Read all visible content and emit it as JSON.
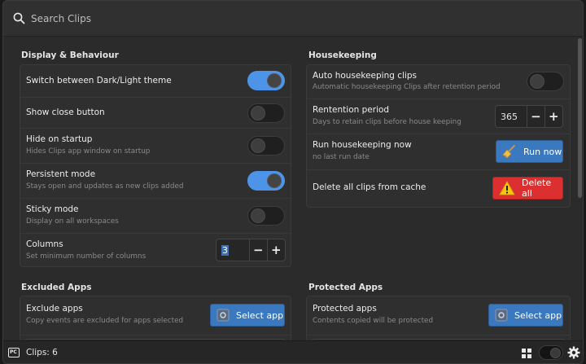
{
  "search": {
    "placeholder": "Search Clips"
  },
  "display": {
    "title": "Display & Behaviour",
    "rows": [
      {
        "title": "Switch between Dark/Light theme",
        "sub": "",
        "toggle": true
      },
      {
        "title": "Show close button",
        "sub": "",
        "toggle": false
      },
      {
        "title": "Hide on startup",
        "sub": "Hides Clips app window on startup",
        "toggle": false
      },
      {
        "title": "Persistent mode",
        "sub": "Stays open and updates as new clips added",
        "toggle": true
      },
      {
        "title": "Sticky mode",
        "sub": "Display on all workspaces",
        "toggle": false
      },
      {
        "title": "Columns",
        "sub": "Set minimum number of columns",
        "value": "3"
      }
    ]
  },
  "housekeeping": {
    "title": "Housekeeping",
    "auto": {
      "title": "Auto housekeeping clips",
      "sub": "Automatic housekeeping Clips after retention period",
      "toggle": false
    },
    "retention": {
      "title": "Rentention period",
      "sub": "Days to retain clips before house keeping",
      "value": "365"
    },
    "run": {
      "title": "Run housekeeping now",
      "sub": "no last run date",
      "button": "Run now"
    },
    "delete": {
      "title": "Delete all clips from cache",
      "button": "Delete all"
    }
  },
  "excluded": {
    "title": "Excluded Apps",
    "row": {
      "title": "Exclude apps",
      "sub": "Copy events are excluded for apps selected",
      "button": "Select app"
    }
  },
  "protected": {
    "title": "Protected Apps",
    "row": {
      "title": "Protected apps",
      "sub": "Contents copied will be protected",
      "button": "Select app"
    }
  },
  "status": {
    "count": "Clips: 6",
    "logo": "PC"
  },
  "colors": {
    "accent": "#4d94e8",
    "button_blue": "#3a78c0",
    "button_red": "#dc2f2f"
  },
  "icons": {
    "search": "search-icon",
    "gear": "gear-icon",
    "grid": "grid-view-icon",
    "broom": "broom-icon",
    "warning": "warning-icon"
  }
}
